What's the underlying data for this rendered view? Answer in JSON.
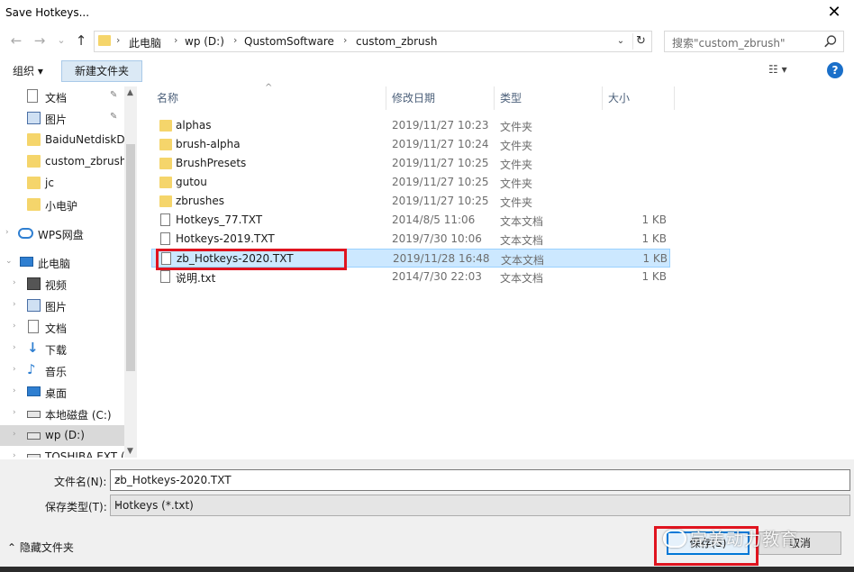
{
  "window": {
    "title": "Save Hotkeys...",
    "close_glyph": "✕"
  },
  "nav": {
    "back_glyph": "←",
    "forward_glyph": "→",
    "recent_glyph": "⌄",
    "up_glyph": "↑",
    "breadcrumbs": [
      "此电脑",
      "wp (D:)",
      "QustomSoftware",
      "custom_zbrush"
    ],
    "crumb_separator": "›",
    "dropdown_glyph": "⌄",
    "refresh_glyph": "↻",
    "search_placeholder": "搜索\"custom_zbrush\""
  },
  "toolbar": {
    "organize_label": "组织 ▾",
    "new_folder_label": "新建文件夹",
    "view_label": "☷ ▾",
    "help_label": "?"
  },
  "sidebar": {
    "items": [
      {
        "label": "文档",
        "icon": "document-icon",
        "pinned": true
      },
      {
        "label": "图片",
        "icon": "pictures-icon",
        "pinned": true
      },
      {
        "label": "BaiduNetdiskD",
        "icon": "folder-icon"
      },
      {
        "label": "custom_zbrush",
        "icon": "folder-icon"
      },
      {
        "label": "jc",
        "icon": "folder-icon"
      },
      {
        "label": "小电驴",
        "icon": "folder-icon"
      },
      {
        "label": "WPS网盘",
        "icon": "cloud-icon"
      },
      {
        "label": "此电脑",
        "icon": "computer-icon"
      },
      {
        "label": "视频",
        "icon": "video-icon"
      },
      {
        "label": "图片",
        "icon": "pictures-icon"
      },
      {
        "label": "文档",
        "icon": "document-icon"
      },
      {
        "label": "下载",
        "icon": "download-icon"
      },
      {
        "label": "音乐",
        "icon": "music-icon"
      },
      {
        "label": "桌面",
        "icon": "desktop-icon"
      },
      {
        "label": "本地磁盘 (C:)",
        "icon": "drive-icon"
      },
      {
        "label": "wp (D:)",
        "icon": "drive-icon",
        "selected": true
      },
      {
        "label": "TOSHIBA EXT (",
        "icon": "drive-icon"
      }
    ],
    "pin_glyph": "📌"
  },
  "filelist": {
    "columns": [
      "名称",
      "修改日期",
      "类型",
      "大小"
    ],
    "sort_glyph": "^",
    "rows": [
      {
        "name": "alphas",
        "date": "2019/11/27 10:23",
        "type": "文件夹",
        "size": "",
        "kind": "folder"
      },
      {
        "name": "brush-alpha",
        "date": "2019/11/27 10:24",
        "type": "文件夹",
        "size": "",
        "kind": "folder"
      },
      {
        "name": "BrushPresets",
        "date": "2019/11/27 10:25",
        "type": "文件夹",
        "size": "",
        "kind": "folder"
      },
      {
        "name": "gutou",
        "date": "2019/11/27 10:25",
        "type": "文件夹",
        "size": "",
        "kind": "folder"
      },
      {
        "name": "zbrushes",
        "date": "2019/11/27 10:25",
        "type": "文件夹",
        "size": "",
        "kind": "folder"
      },
      {
        "name": "Hotkeys_77.TXT",
        "date": "2014/8/5 11:06",
        "type": "文本文档",
        "size": "1 KB",
        "kind": "doc"
      },
      {
        "name": "Hotkeys-2019.TXT",
        "date": "2019/7/30 10:06",
        "type": "文本文档",
        "size": "1 KB",
        "kind": "doc"
      },
      {
        "name": "zb_Hotkeys-2020.TXT",
        "date": "2019/11/28 16:48",
        "type": "文本文档",
        "size": "1 KB",
        "kind": "doc",
        "selected": true
      },
      {
        "name": "说明.txt",
        "date": "2014/7/30 22:03",
        "type": "文本文档",
        "size": "1 KB",
        "kind": "doc"
      }
    ]
  },
  "bottom": {
    "filename_label": "文件名(N):",
    "filename_value": "zb_Hotkeys-2020.TXT",
    "filetype_label": "保存类型(T):",
    "filetype_value": "Hotkeys (*.txt)",
    "dropdown_glyph": "⌄",
    "hide_folders_label": "⌃  隐藏文件夹",
    "save_label": "保存(S)",
    "cancel_label": "取消",
    "watermark_text": "完美动力教育"
  },
  "colors": {
    "accent": "#0078d7",
    "selection": "#cce8ff",
    "annotation_red": "#e0141f",
    "folder": "#f5d56b"
  }
}
